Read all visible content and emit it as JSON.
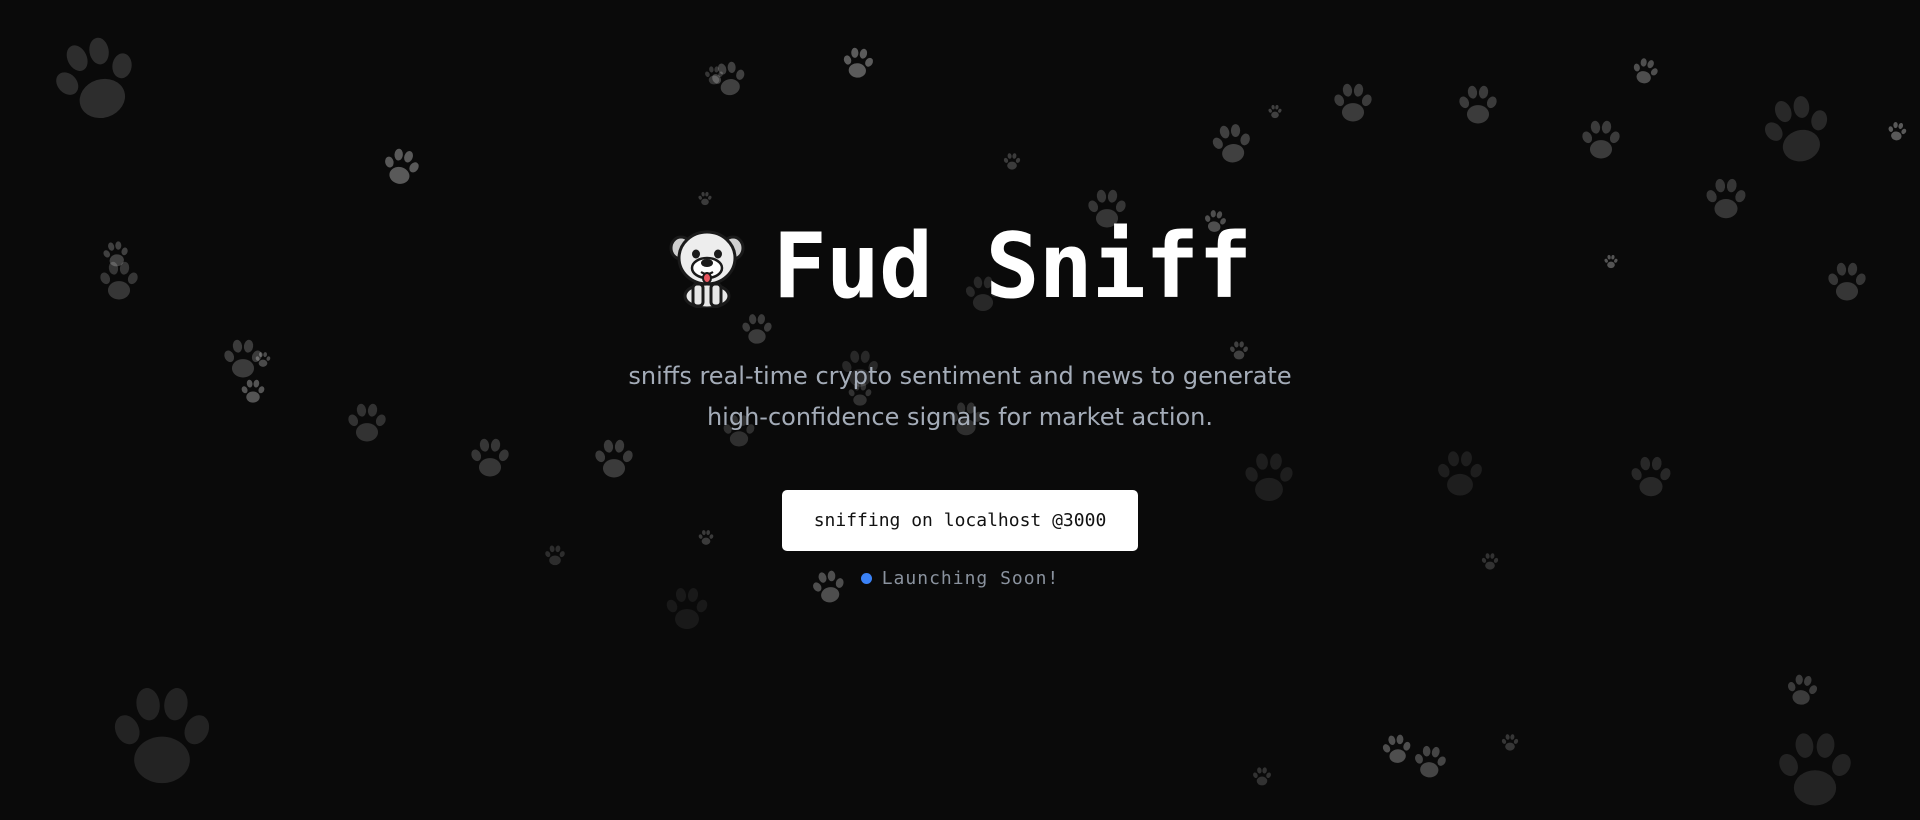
{
  "hero": {
    "title": "Fud Sniff",
    "logo_icon": "dog-face-icon",
    "subtitle_line1": "sniffs real-time crypto sentiment and news to generate",
    "subtitle_line2": "high-confidence signals for market action.",
    "cta_label": "sniffing on localhost @3000",
    "status_text": "Launching Soon!"
  },
  "background": {
    "decoration_icon": "paw-print-icon"
  },
  "colors": {
    "background": "#0a0a0a",
    "title": "#ffffff",
    "subtitle": "#a4acb8",
    "button_bg": "#ffffff",
    "button_text": "#111111",
    "status_dot": "#3b82f6",
    "status_text": "#8a929e"
  }
}
